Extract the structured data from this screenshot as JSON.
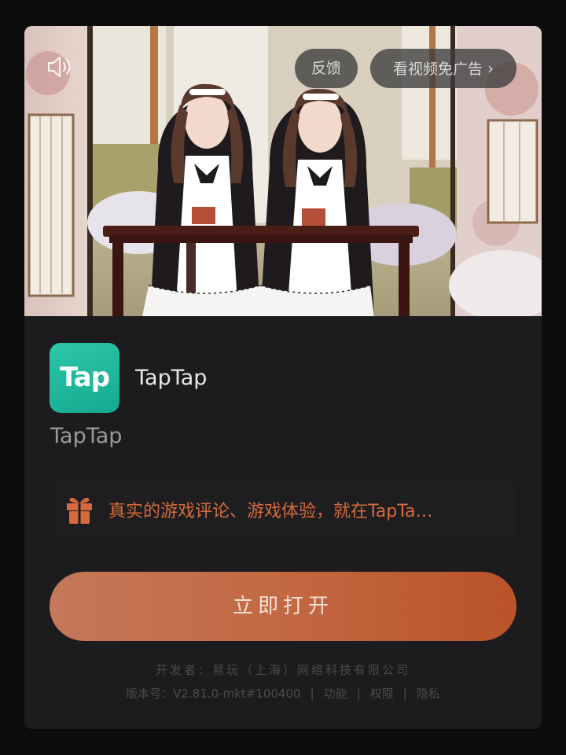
{
  "ad": {
    "feedback_label": "反馈",
    "skip_label": "看视频免广告",
    "skip_chevron": "›",
    "mute_icon": "speaker-icon"
  },
  "app": {
    "icon_text": "Tap",
    "name": "TapTap",
    "subtitle": "TapTap",
    "icon_colors": [
      "#2ec7a9",
      "#14a98f"
    ]
  },
  "promo": {
    "icon": "gift-icon",
    "text": "真实的游戏评论、游戏体验，就在TapTa…",
    "color": "#d66a3c"
  },
  "cta": {
    "label": "立即打开",
    "color": "#c2663f"
  },
  "footer": {
    "developer": "开发者：易玩（上海）网络科技有限公司",
    "version": "版本号：V2.81.0-mkt#100400",
    "links": [
      "功能",
      "权限",
      "隐私"
    ]
  }
}
